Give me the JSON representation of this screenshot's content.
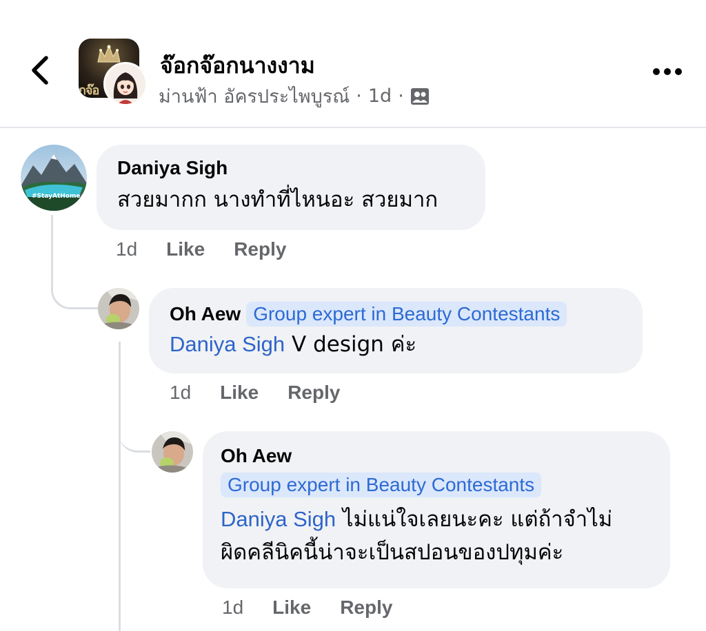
{
  "header": {
    "group_name": "จ๊อกจ๊อกนางงาม",
    "poster_name": "ม่านฟ้า อัครประไพบูรณ์",
    "separator": "·",
    "post_time": "1d",
    "group_avatar_text": "กจ๊อ",
    "back_icon": "chevron-left-icon",
    "more_icon": "ellipsis-icon",
    "privacy_icon": "members-icon"
  },
  "comments": [
    {
      "author": "Daniya Sigh",
      "text": "สวยมากก นางทำที่ไหนอะ สวยมาก",
      "avatar_text": "#StayAtHome",
      "time": "1d",
      "like_label": "Like",
      "reply_label": "Reply"
    },
    {
      "author": "Oh Aew",
      "badge": "Group expert in Beauty Contestants",
      "mention": "Daniya Sigh",
      "text": " V design ค่ะ",
      "time": "1d",
      "like_label": "Like",
      "reply_label": "Reply"
    },
    {
      "author": "Oh Aew",
      "badge": "Group expert in Beauty Contestants",
      "mention": "Daniya Sigh",
      "text_line1": " ไม่แน่ใจเลยนะคะ แต่ถ้าจำไม่",
      "text_line2": "ผิดคลีนิคนี้น่าจะเป็นสปอนของปทุมค่ะ",
      "time": "1d",
      "like_label": "Like",
      "reply_label": "Reply"
    }
  ],
  "colors": {
    "bubble": "#f0f2f5",
    "badge_bg": "#dbe7fb",
    "badge_text": "#2d6ad4",
    "mention": "#2e64c8",
    "meta": "#65676b"
  }
}
